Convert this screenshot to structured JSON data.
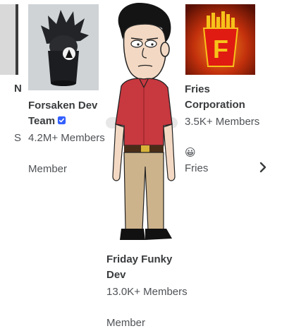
{
  "cards": {
    "left_partial": {
      "name_fragment": "N",
      "meta_fragment": "S"
    },
    "forsaken": {
      "name": "Forsaken Dev Team",
      "verified": true,
      "members": "4.2M+ Members",
      "status": "Member"
    },
    "fries": {
      "name": "Fries Corporation",
      "members": "3.5K+ Members",
      "badge_emoji": "😀",
      "badge_text": "Fries",
      "logo_letter": "F"
    },
    "friday": {
      "name": "Friday Funky Dev",
      "members": "13.0K+ Members",
      "status": "Member"
    }
  },
  "icons": {
    "next": "chevron-right-icon",
    "verified": "verified-badge-icon"
  },
  "colors": {
    "verified": "#335fff",
    "text": "#393b3d",
    "fries_red": "#e01b12",
    "fries_yellow": "#f7c21a"
  }
}
